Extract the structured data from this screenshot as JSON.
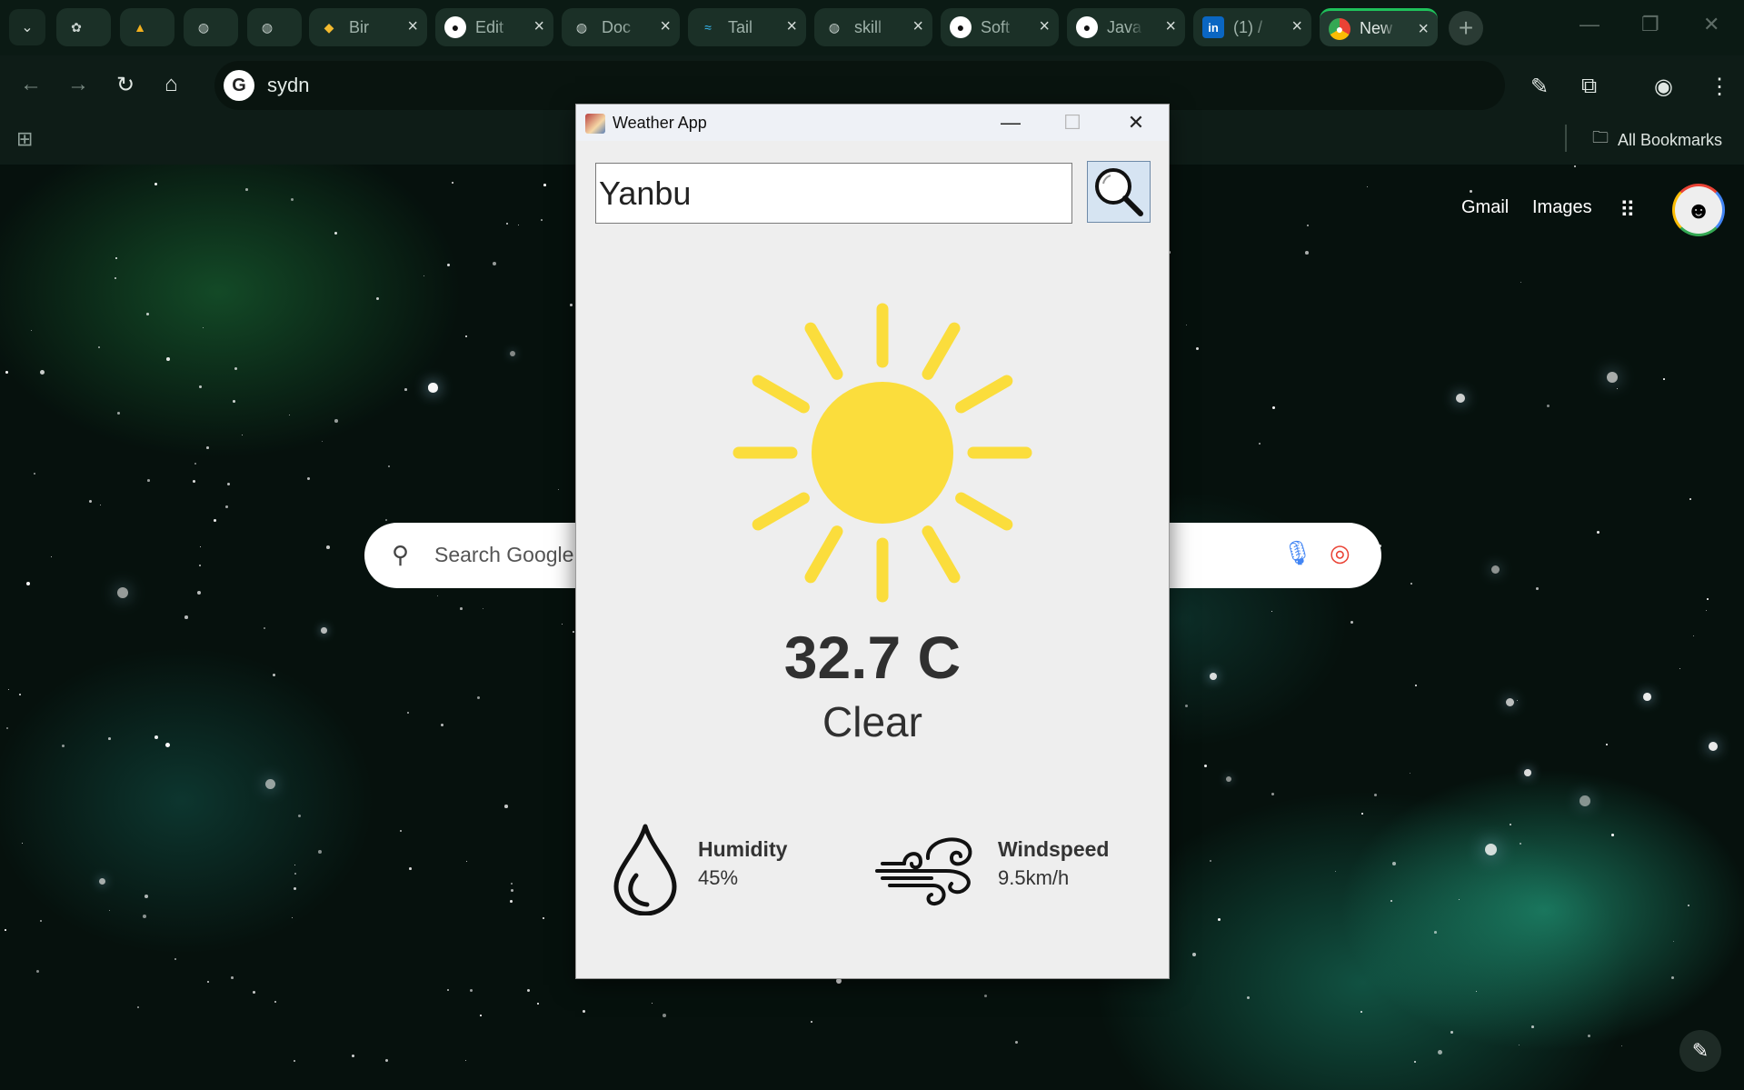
{
  "browser": {
    "tabs": [
      {
        "title": "",
        "icon": "puzzle-icon"
      },
      {
        "title": "",
        "icon": "chart-icon"
      },
      {
        "title": "",
        "icon": "globe-icon"
      },
      {
        "title": "",
        "icon": "globe-icon"
      },
      {
        "title": "Bir",
        "icon": "binance-icon"
      },
      {
        "title": "Edit",
        "icon": "github-icon"
      },
      {
        "title": "Doc",
        "icon": "globe-icon"
      },
      {
        "title": "Tail",
        "icon": "tailwind-icon"
      },
      {
        "title": "skill",
        "icon": "globe-icon"
      },
      {
        "title": "Soft",
        "icon": "github-icon"
      },
      {
        "title": "Java",
        "icon": "github-icon"
      },
      {
        "title": "(1) /",
        "icon": "linkedin-icon"
      },
      {
        "title": "New",
        "icon": "chrome-icon",
        "active": true
      }
    ],
    "address": "sydn",
    "bookmarks_label": "All Bookmarks",
    "accent": "#1fc25b"
  },
  "ntp": {
    "gmail": "Gmail",
    "images": "Images",
    "search_placeholder": "Search Google"
  },
  "weather_app": {
    "window_title": "Weather App",
    "city": "Yanbu",
    "temperature": "32.7 C",
    "condition": "Clear",
    "condition_icon": "sun-icon",
    "humidity_label": "Humidity",
    "humidity_value": "45%",
    "windspeed_label": "Windspeed",
    "windspeed_value": "9.5km/h",
    "sun_color": "#fbdd3c"
  }
}
